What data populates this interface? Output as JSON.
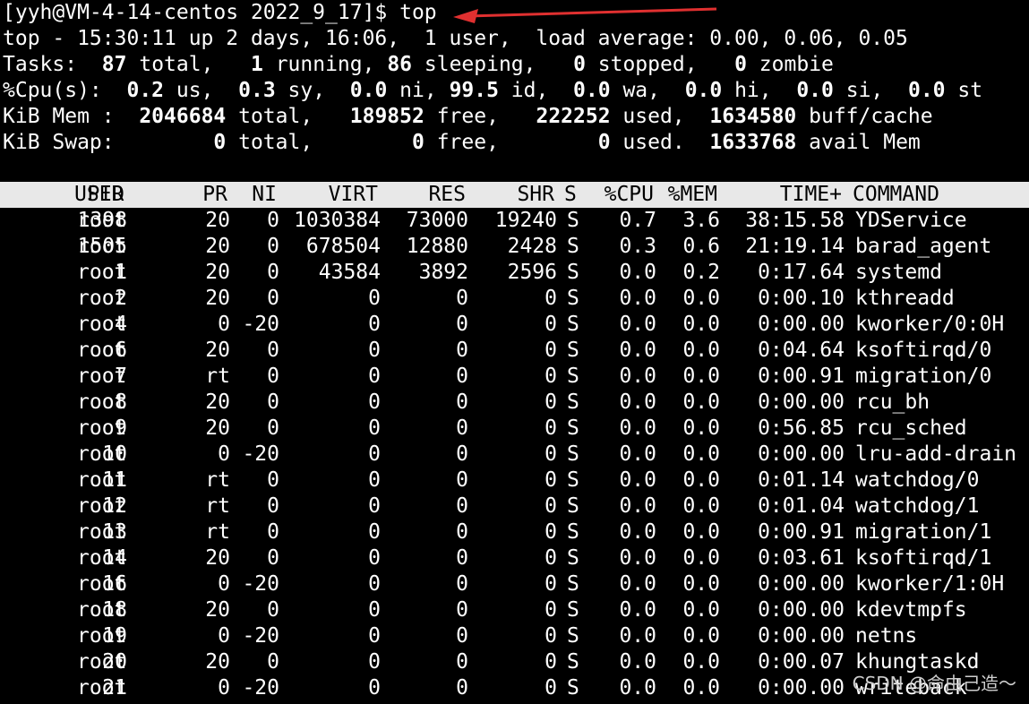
{
  "prompt_line": "[yyh@VM-4-14-centos 2022_9_17]$ top",
  "summary": {
    "line1": "top - 15:30:11 up 2 days, 16:06,  1 user,  load average: 0.00, 0.06, 0.05",
    "tasks": {
      "label": "Tasks:",
      "total": "87",
      "total_l": " total,",
      "running": "1",
      "running_l": " running,",
      "sleeping": "86",
      "sleeping_l": " sleeping,",
      "stopped": "0",
      "stopped_l": " stopped,",
      "zombie": "0",
      "zombie_l": " zombie"
    },
    "cpu": {
      "label": "%Cpu(s):",
      "us": "0.2",
      "sy": "0.3",
      "ni": "0.0",
      "id": "99.5",
      "wa": "0.0",
      "hi": "0.0",
      "si": "0.0",
      "st": "0.0"
    },
    "mem": {
      "label": "KiB Mem :",
      "total": "2046684",
      "free": "189852",
      "used": "222252",
      "buff": "1634580"
    },
    "swap": {
      "label": "KiB Swap:",
      "total": "0",
      "free": "0",
      "used": "0",
      "avail": "1633768"
    }
  },
  "columns": [
    "PID",
    "USER",
    "PR",
    "NI",
    "VIRT",
    "RES",
    "SHR",
    "S",
    "%CPU",
    "%MEM",
    "TIME+",
    "COMMAND"
  ],
  "processes": [
    [
      "1398",
      "root",
      "20",
      "0",
      "1030384",
      "73000",
      "19240",
      "S",
      "0.7",
      "3.6",
      "38:15.58",
      "YDService"
    ],
    [
      "1505",
      "root",
      "20",
      "0",
      "678504",
      "12880",
      "2428",
      "S",
      "0.3",
      "0.6",
      "21:19.14",
      "barad_agent"
    ],
    [
      "1",
      "root",
      "20",
      "0",
      "43584",
      "3892",
      "2596",
      "S",
      "0.0",
      "0.2",
      "0:17.64",
      "systemd"
    ],
    [
      "2",
      "root",
      "20",
      "0",
      "0",
      "0",
      "0",
      "S",
      "0.0",
      "0.0",
      "0:00.10",
      "kthreadd"
    ],
    [
      "4",
      "root",
      "0",
      "-20",
      "0",
      "0",
      "0",
      "S",
      "0.0",
      "0.0",
      "0:00.00",
      "kworker/0:0H"
    ],
    [
      "6",
      "root",
      "20",
      "0",
      "0",
      "0",
      "0",
      "S",
      "0.0",
      "0.0",
      "0:04.64",
      "ksoftirqd/0"
    ],
    [
      "7",
      "root",
      "rt",
      "0",
      "0",
      "0",
      "0",
      "S",
      "0.0",
      "0.0",
      "0:00.91",
      "migration/0"
    ],
    [
      "8",
      "root",
      "20",
      "0",
      "0",
      "0",
      "0",
      "S",
      "0.0",
      "0.0",
      "0:00.00",
      "rcu_bh"
    ],
    [
      "9",
      "root",
      "20",
      "0",
      "0",
      "0",
      "0",
      "S",
      "0.0",
      "0.0",
      "0:56.85",
      "rcu_sched"
    ],
    [
      "10",
      "root",
      "0",
      "-20",
      "0",
      "0",
      "0",
      "S",
      "0.0",
      "0.0",
      "0:00.00",
      "lru-add-drain"
    ],
    [
      "11",
      "root",
      "rt",
      "0",
      "0",
      "0",
      "0",
      "S",
      "0.0",
      "0.0",
      "0:01.14",
      "watchdog/0"
    ],
    [
      "12",
      "root",
      "rt",
      "0",
      "0",
      "0",
      "0",
      "S",
      "0.0",
      "0.0",
      "0:01.04",
      "watchdog/1"
    ],
    [
      "13",
      "root",
      "rt",
      "0",
      "0",
      "0",
      "0",
      "S",
      "0.0",
      "0.0",
      "0:00.91",
      "migration/1"
    ],
    [
      "14",
      "root",
      "20",
      "0",
      "0",
      "0",
      "0",
      "S",
      "0.0",
      "0.0",
      "0:03.61",
      "ksoftirqd/1"
    ],
    [
      "16",
      "root",
      "0",
      "-20",
      "0",
      "0",
      "0",
      "S",
      "0.0",
      "0.0",
      "0:00.00",
      "kworker/1:0H"
    ],
    [
      "18",
      "root",
      "20",
      "0",
      "0",
      "0",
      "0",
      "S",
      "0.0",
      "0.0",
      "0:00.00",
      "kdevtmpfs"
    ],
    [
      "19",
      "root",
      "0",
      "-20",
      "0",
      "0",
      "0",
      "S",
      "0.0",
      "0.0",
      "0:00.00",
      "netns"
    ],
    [
      "20",
      "root",
      "20",
      "0",
      "0",
      "0",
      "0",
      "S",
      "0.0",
      "0.0",
      "0:00.07",
      "khungtaskd"
    ],
    [
      "21",
      "root",
      "0",
      "-20",
      "0",
      "0",
      "0",
      "S",
      "0.0",
      "0.0",
      "0:00.00",
      "writeback"
    ]
  ],
  "arrow_color": "#e03030",
  "watermark": "CSDN @命由己造～"
}
